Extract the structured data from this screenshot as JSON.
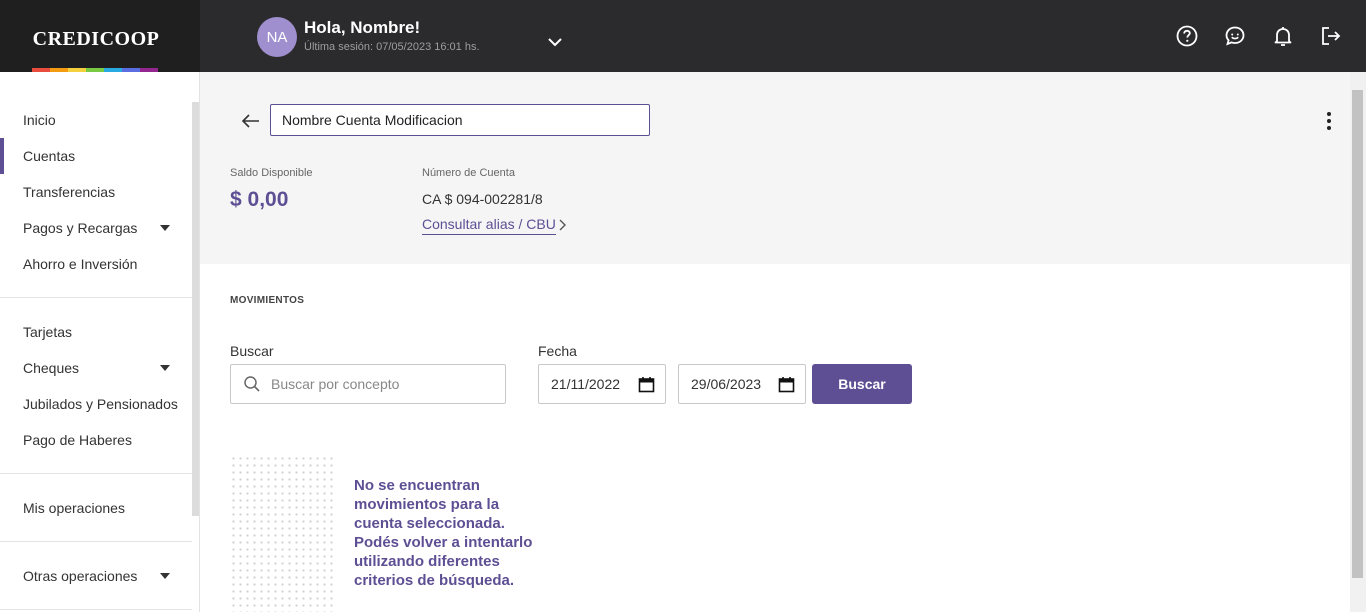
{
  "brand": {
    "logo_text": "CREDICOOP",
    "rainbow_colors": [
      "#e74c3c",
      "#f39c12",
      "#f4d03f",
      "#7ac943",
      "#29abe2",
      "#5b6ee1",
      "#93278f"
    ]
  },
  "user": {
    "initials": "NA",
    "greeting": "Hola, Nombre!",
    "last_session": "Última sesión: 07/05/2023 16:01 hs."
  },
  "top_icons": [
    "help-icon",
    "chat-icon",
    "bell-icon",
    "logout-icon"
  ],
  "sidebar": {
    "items": [
      {
        "label": "Inicio"
      },
      {
        "label": "Cuentas",
        "active": true
      },
      {
        "label": "Transferencias"
      },
      {
        "label": "Pagos y Recargas",
        "expandable": true
      },
      {
        "label": "Ahorro e Inversión"
      },
      {
        "label": "Tarjetas"
      },
      {
        "label": "Cheques",
        "expandable": true
      },
      {
        "label": "Jubilados y Pensionados"
      },
      {
        "label": "Pago de Haberes"
      },
      {
        "label": "Mis operaciones"
      },
      {
        "label": "Otras operaciones",
        "expandable": true
      }
    ]
  },
  "account": {
    "name_value": "Nombre Cuenta Modificacion",
    "balance_label": "Saldo Disponible",
    "balance": "$ 0,00",
    "number_label": "Número de Cuenta",
    "number": "CA $ 094-002281/8",
    "alias_link": "Consultar alias / CBU"
  },
  "movements": {
    "section_title": "MOVIMIENTOS",
    "search_label": "Buscar",
    "search_placeholder": "Buscar por concepto",
    "date_label": "Fecha",
    "date_from": "21/11/2022",
    "date_to": "29/06/2023",
    "search_button": "Buscar",
    "empty_message": "No se encuentran movimientos para la cuenta seleccionada. Podés volver a intentarlo utilizando diferentes criterios de búsqueda."
  },
  "colors": {
    "accent": "#5e4f94",
    "topbar": "#2b2b2d",
    "avatar": "#9f8fce"
  }
}
